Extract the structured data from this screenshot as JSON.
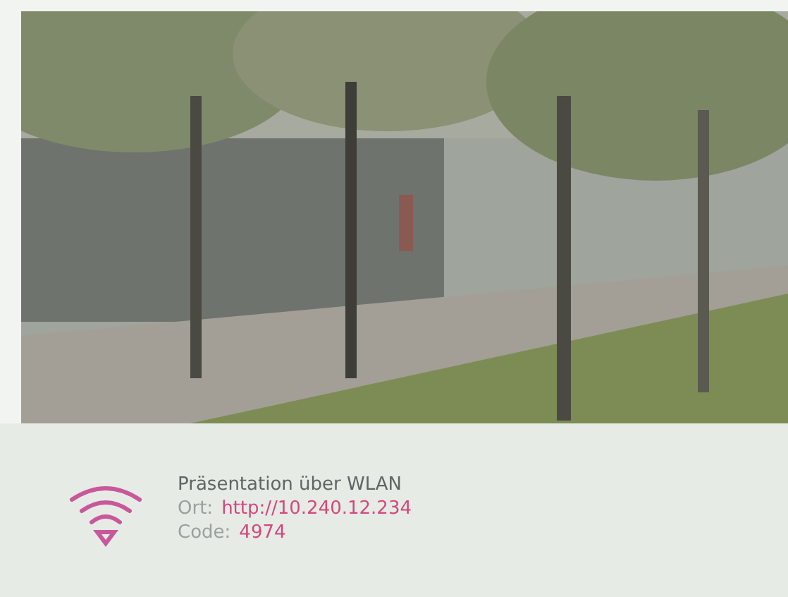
{
  "info": {
    "title": "Präsentation über WLAN",
    "rows": [
      {
        "label": "Ort:",
        "value": "http://10.240.12.234"
      },
      {
        "label": "Code:",
        "value": "4974"
      }
    ]
  }
}
